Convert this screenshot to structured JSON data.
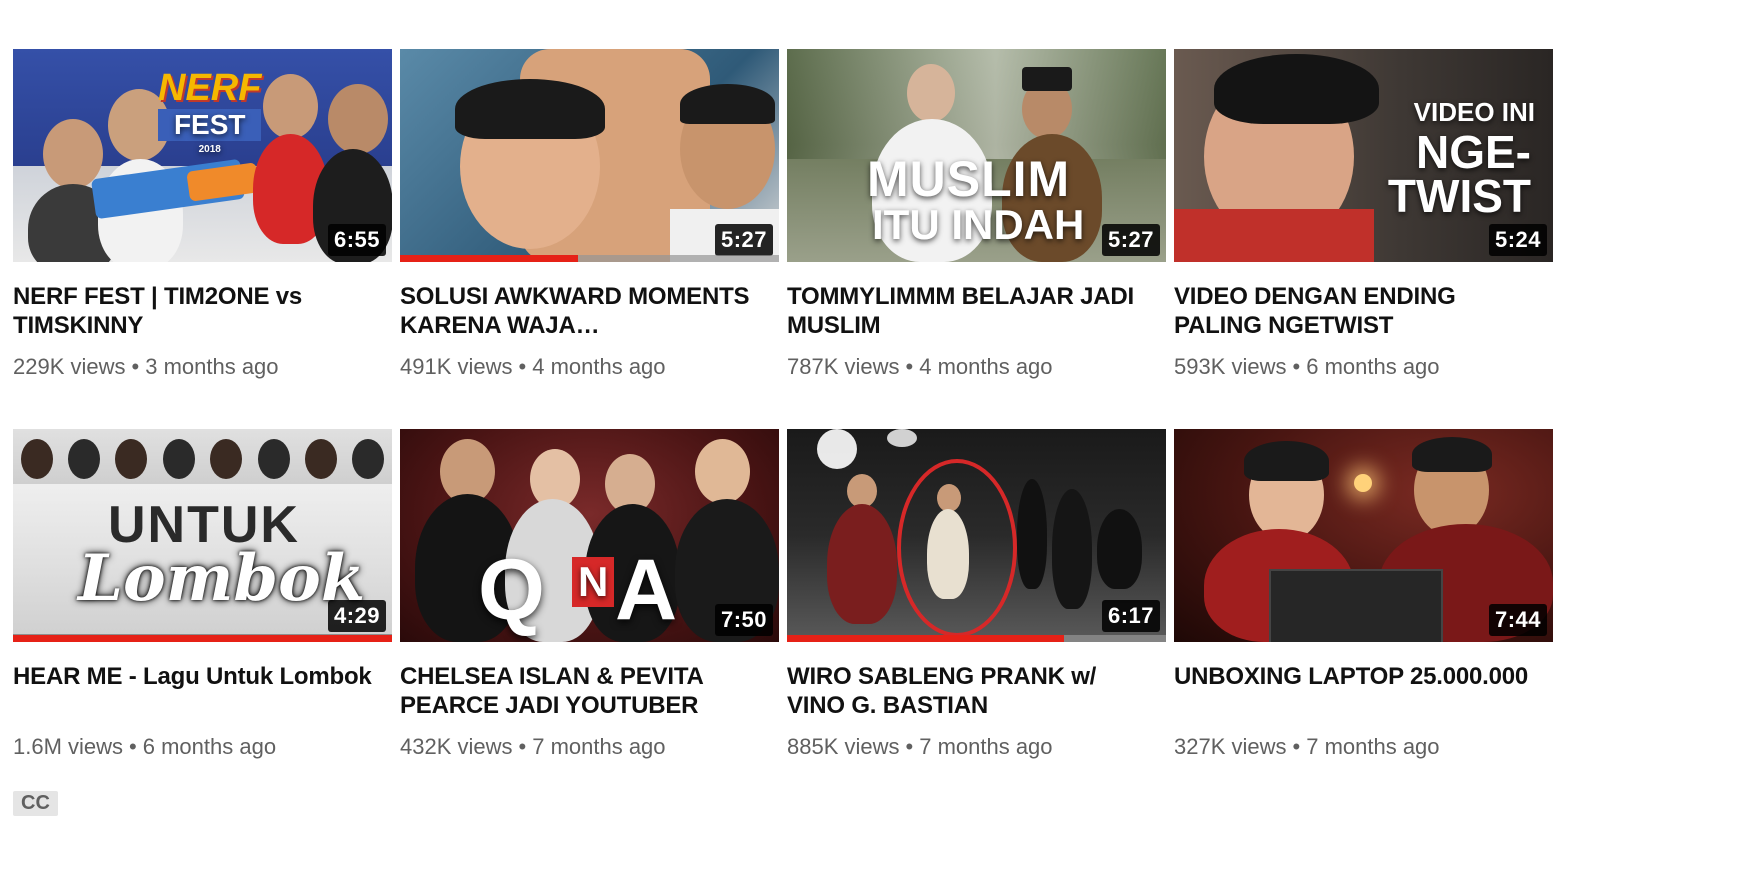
{
  "videos": [
    {
      "title": "NERF FEST | TIM2ONE vs TIMSKINNY",
      "views": "229K views",
      "age": "3 months ago",
      "duration": "6:55",
      "progress": 0,
      "thumb_text": [
        "NERF",
        "FEST"
      ],
      "thumb_small": "2018",
      "bg": "#2a3f8f"
    },
    {
      "title": "SOLUSI AWKWARD MOMENTS KARENA WAJA…",
      "views": "491K views",
      "age": "4 months ago",
      "duration": "5:27",
      "progress": 0.47,
      "thumb_text": [],
      "bg": "#3a6a8a"
    },
    {
      "title": "TOMMYLIMMM BELAJAR JADI MUSLIM",
      "views": "787K views",
      "age": "4 months ago",
      "duration": "5:27",
      "progress": 0,
      "thumb_text": [
        "MUSLIM",
        "ITU INDAH"
      ],
      "bg": "#6f7a5c"
    },
    {
      "title": "VIDEO DENGAN ENDING PALING NGETWIST",
      "views": "593K views",
      "age": "6 months ago",
      "duration": "5:24",
      "progress": 0,
      "thumb_text": [
        "VIDEO INI",
        "NGE-",
        "TWIST"
      ],
      "bg": "#4a4440"
    },
    {
      "title": "HEAR ME - Lagu Untuk Lombok",
      "views": "1.6M views",
      "age": "6 months ago",
      "duration": "4:29",
      "progress": 1,
      "thumb_text": [
        "UNTUK",
        "Lombok"
      ],
      "bg": "#bdbdbd",
      "badge": "CC"
    },
    {
      "title": "CHELSEA ISLAN & PEVITA PEARCE JADI YOUTUBER",
      "views": "432K views",
      "age": "7 months ago",
      "duration": "7:50",
      "progress": 0,
      "thumb_text": [
        "Q",
        "N",
        "A"
      ],
      "bg": "#5a1a1a"
    },
    {
      "title": "WIRO SABLENG PRANK w/ VINO G. BASTIAN",
      "views": "885K views",
      "age": "7 months ago",
      "duration": "6:17",
      "progress": 0.73,
      "thumb_text": [],
      "bg": "#1e1e1e"
    },
    {
      "title": "UNBOXING LAPTOP 25.000.000",
      "views": "327K views",
      "age": "7 months ago",
      "duration": "7:44",
      "progress": 0,
      "thumb_text": [],
      "bg": "#3a1412"
    }
  ],
  "separator": "•"
}
